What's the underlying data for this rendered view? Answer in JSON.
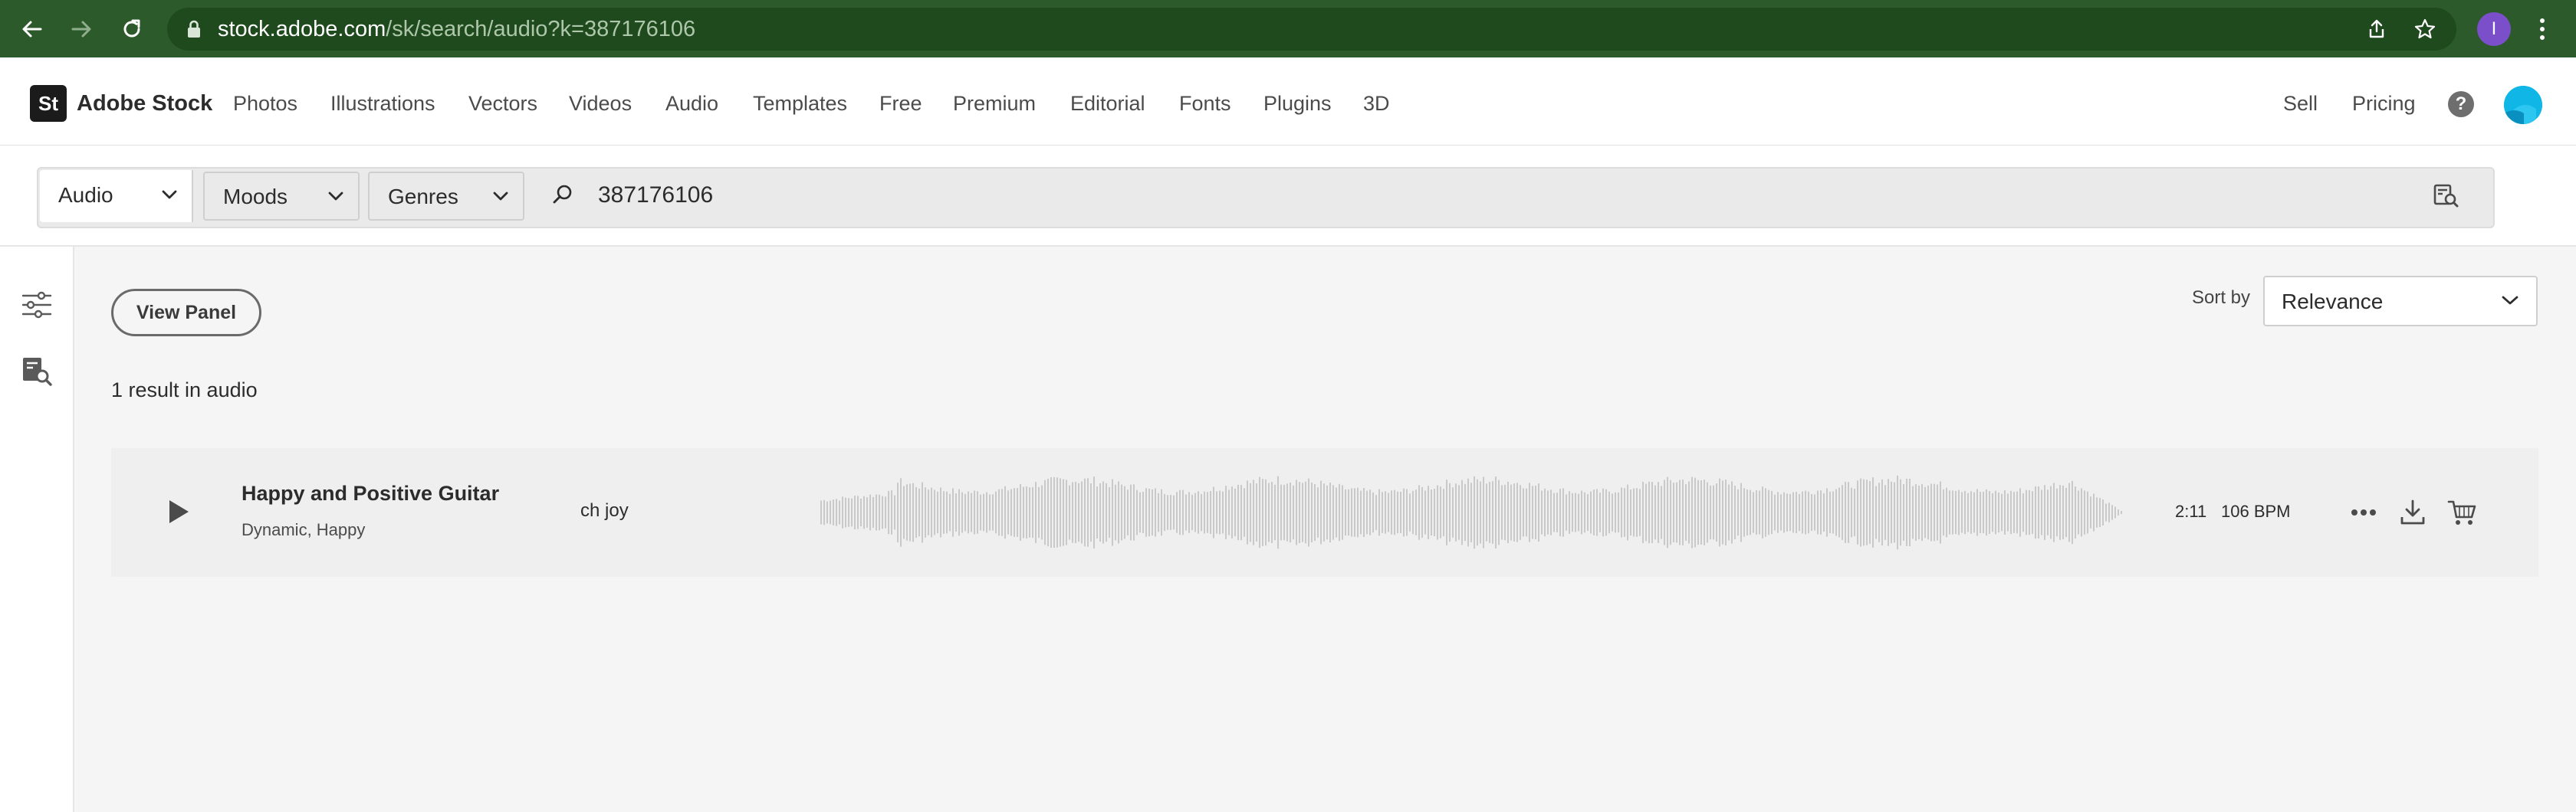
{
  "browser": {
    "url_host": "stock.adobe.com",
    "url_path": "/sk/search/audio?k=387176106",
    "profile_initial": "I"
  },
  "header": {
    "logo_mark": "St",
    "logo_text": "Adobe Stock",
    "nav": [
      "Photos",
      "Illustrations",
      "Vectors",
      "Videos",
      "Audio",
      "Templates",
      "Free",
      "Premium",
      "Editorial",
      "Fonts",
      "Plugins",
      "3D"
    ],
    "sell": "Sell",
    "pricing": "Pricing",
    "help": "?"
  },
  "search": {
    "category": "Audio",
    "moods": "Moods",
    "genres": "Genres",
    "query": "387176106"
  },
  "toolbar": {
    "view_panel": "View Panel",
    "sort_label": "Sort by",
    "sort_value": "Relevance"
  },
  "results": {
    "count_text": "1 result in audio",
    "items": [
      {
        "title": "Happy and Positive Guitar",
        "tags": "Dynamic, Happy",
        "artist": "ch joy",
        "duration": "2:11",
        "bpm": "106 BPM"
      }
    ]
  },
  "icons": {
    "back": "arrow-left-icon",
    "forward": "arrow-right-icon",
    "reload": "reload-icon",
    "lock": "lock-icon",
    "share": "share-icon",
    "bookmark": "star-icon",
    "menu": "kebab-menu-icon",
    "search": "search-icon",
    "visual_search": "visual-search-icon",
    "filters": "filter-sliders-icon",
    "play": "play-icon",
    "more": "more-icon",
    "download": "download-icon",
    "cart": "cart-icon"
  },
  "colors": {
    "browser_chrome": "#2d5a2b",
    "omnibox": "#1f4a1d",
    "avatar_purple": "#7b4fc9",
    "account_cyan": "#0fb6e6",
    "waveform": "#c9c9c9"
  }
}
